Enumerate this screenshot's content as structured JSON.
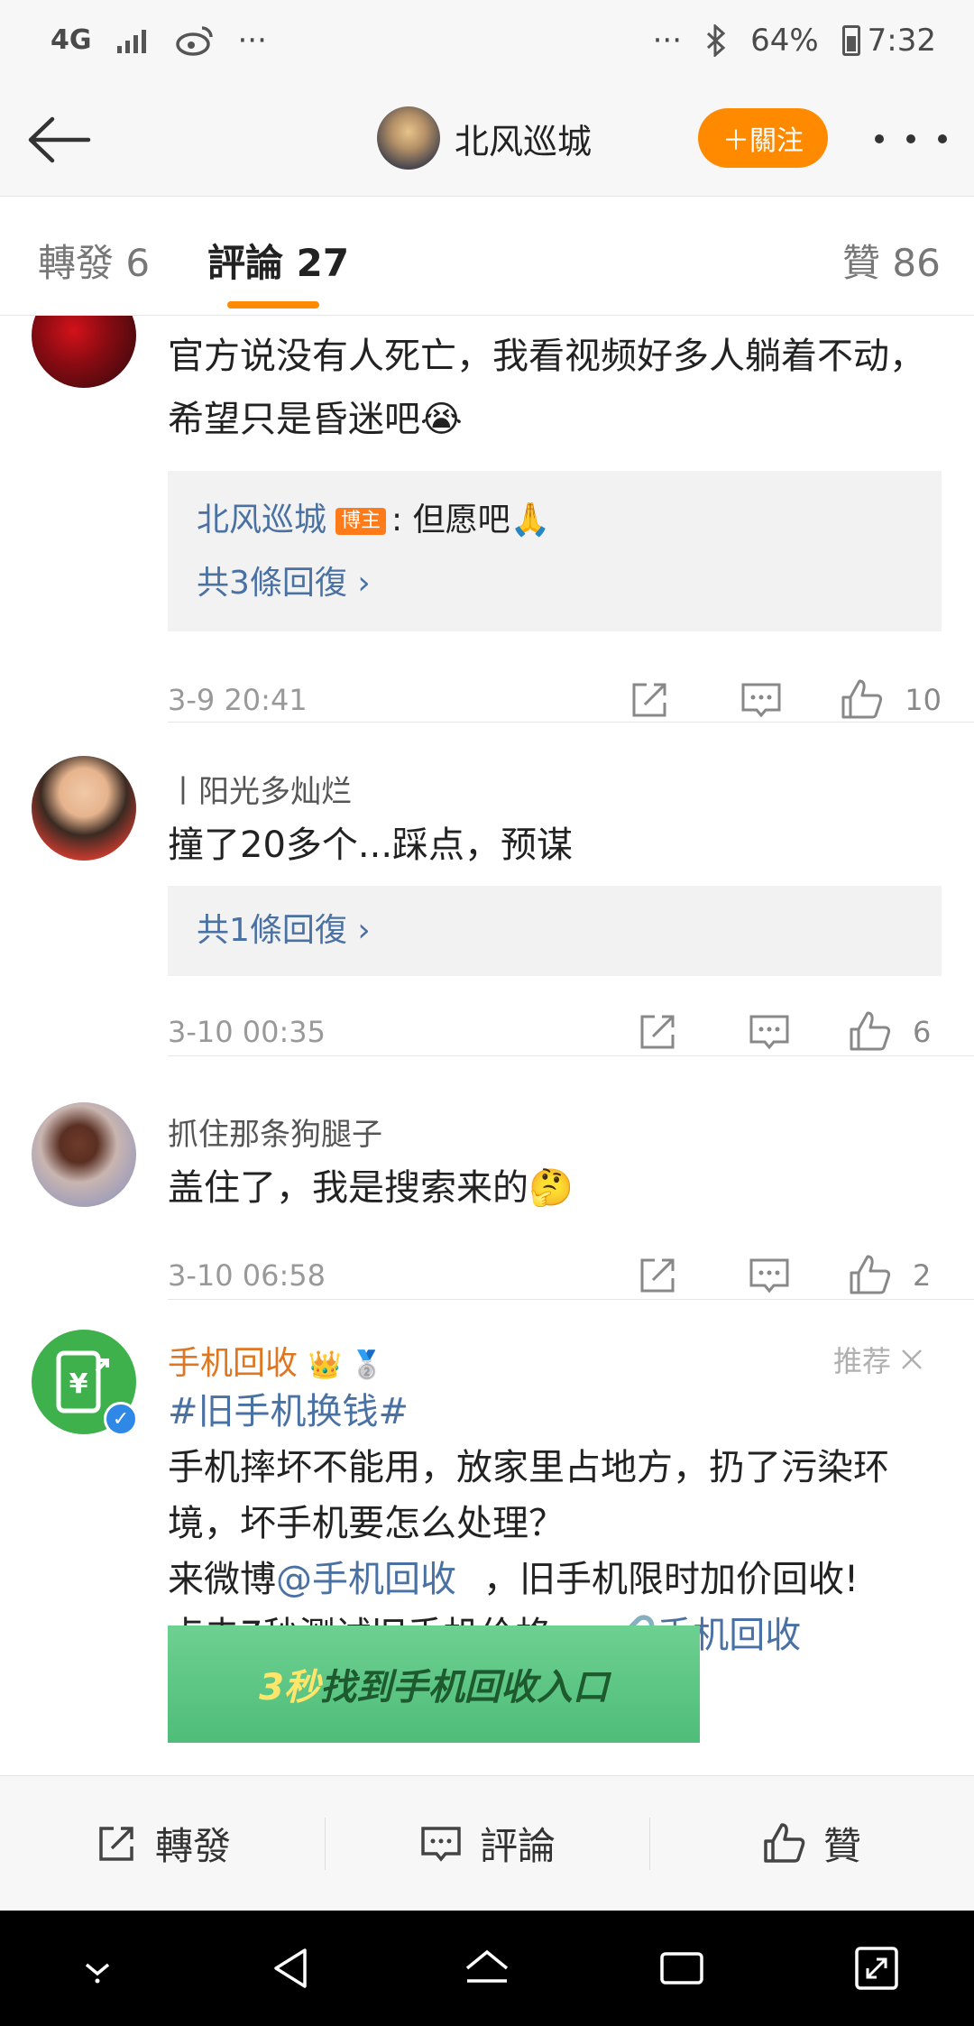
{
  "status_bar": {
    "network": "4G",
    "dots": "···",
    "battery": "64%",
    "time": "7:32"
  },
  "header": {
    "name": "北风巡城",
    "follow": "＋關注"
  },
  "tabs": {
    "repost": "轉發 6",
    "comments": "評論 27",
    "likes": "贊 86"
  },
  "comments": [
    {
      "body": "官方说没有人死亡，我看视频好多人躺着不动，希望只是昏迷吧😭",
      "reply_user": "北风巡城",
      "reply_tag": "博主",
      "reply_text": ": 但愿吧🙏",
      "replies_link": "共3條回復 ›",
      "time": "3-9 20:41",
      "likes": "10"
    },
    {
      "user": "丨阳光多灿烂",
      "body": "撞了20多个...踩点，预谋",
      "replies_link": "共1條回復 ›",
      "time": "3-10 00:35",
      "likes": "6"
    },
    {
      "user": "抓住那条狗腿子",
      "body": "盖住了，我是搜索来的🤔",
      "time": "3-10 06:58",
      "likes": "2"
    }
  ],
  "ad": {
    "name": "手机回收",
    "badges": "👑 🥈",
    "recommend": "推荐",
    "hashtag": "#旧手机换钱#",
    "line1": "手机摔坏不能用，放家里占地方，扔了污染环境，坏手机要怎么处理？",
    "line2_prefix": "来微博",
    "line2_mention": "@手机回收",
    "line2_suffix": "，旧手机限时加价回收!",
    "line3_prefix": "点击7秒测试旧手机价格>>",
    "line3_link": "🔗手机回收",
    "banner_highlight": "3秒",
    "banner_text": "找到手机回收入口"
  },
  "bottom_bar": {
    "repost": "轉發",
    "comment": "評論",
    "like": "贊"
  },
  "colors": {
    "accent": "#ff8a00",
    "link": "#4a71a3",
    "ad_name": "#e0761f"
  }
}
